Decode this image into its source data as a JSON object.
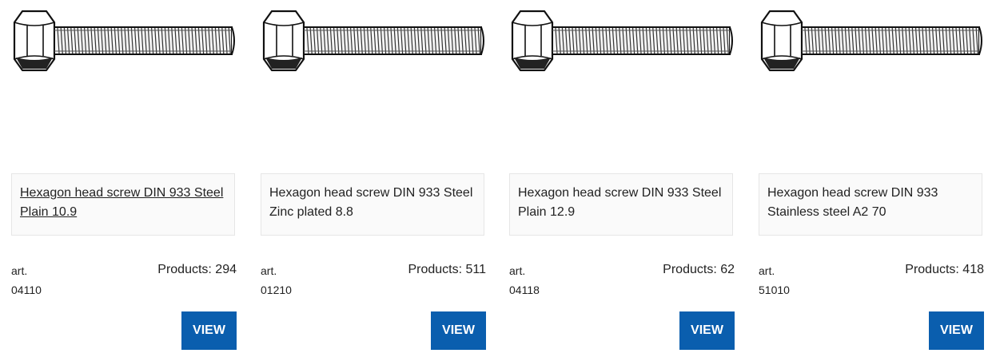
{
  "products": [
    {
      "title": "Hexagon head screw DIN 933 Steel Plain 10.9",
      "art_label": "art.",
      "art_number": "04110",
      "products_label": "Products: 294",
      "button": "VIEW",
      "image_icon": "hexagon-head-bolt-icon"
    },
    {
      "title": "Hexagon head screw DIN 933 Steel Zinc plated 8.8",
      "art_label": "art.",
      "art_number": "01210",
      "products_label": "Products: 511",
      "button": "VIEW",
      "image_icon": "hexagon-head-bolt-icon"
    },
    {
      "title": "Hexagon head screw DIN 933 Steel Plain 12.9",
      "art_label": "art.",
      "art_number": "04118",
      "products_label": "Products: 62",
      "button": "VIEW",
      "image_icon": "hexagon-head-bolt-icon"
    },
    {
      "title": "Hexagon head screw DIN 933 Stainless steel A2 70",
      "art_label": "art.",
      "art_number": "51010",
      "products_label": "Products: 418",
      "button": "VIEW",
      "image_icon": "hexagon-head-bolt-icon"
    }
  ],
  "colors": {
    "button_bg": "#0a5eae",
    "button_text": "#ffffff",
    "title_box_bg": "#fafafa",
    "title_box_border": "#e6e6e6"
  }
}
